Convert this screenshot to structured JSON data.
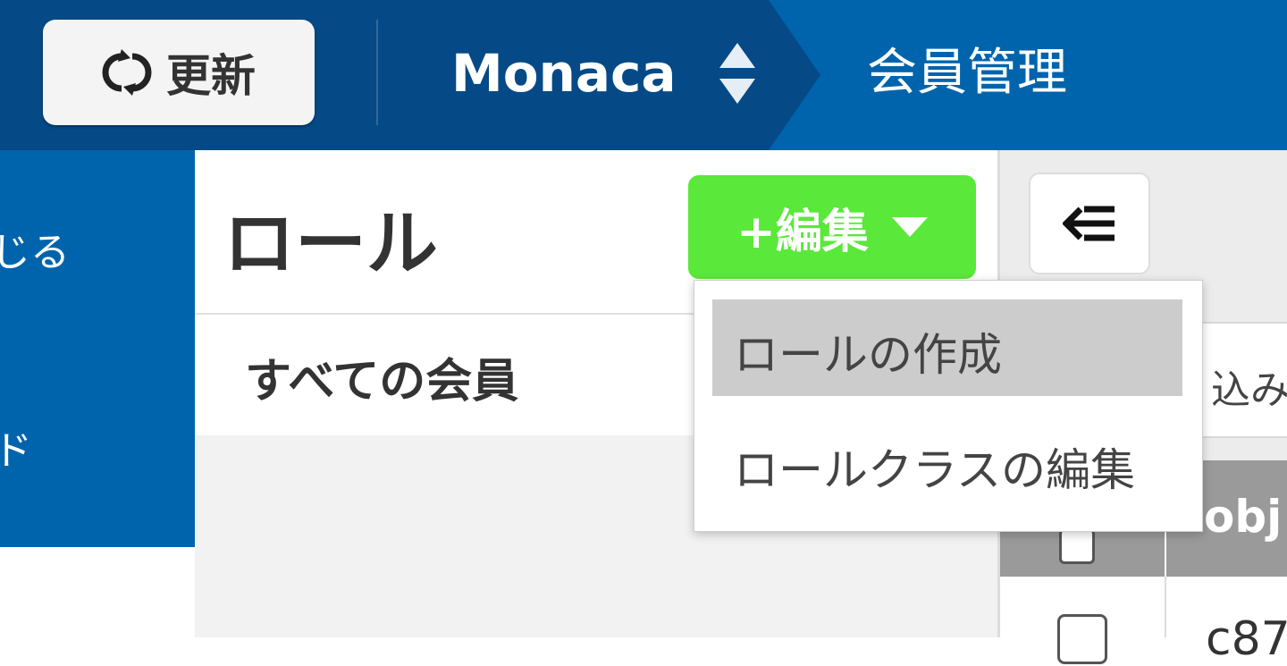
{
  "header": {
    "refresh_label": "更新",
    "app_name": "Monaca",
    "section_title": "会員管理"
  },
  "left_nav": {
    "items": [
      {
        "label": "じる"
      },
      {
        "label": "ド"
      }
    ]
  },
  "role_panel": {
    "title": "ロール",
    "edit_button_label": "+編集",
    "all_members_label": "すべての会員"
  },
  "dropdown": {
    "items": [
      {
        "label": "ロールの作成",
        "highlighted": true
      },
      {
        "label": "ロールクラスの編集",
        "highlighted": false
      }
    ]
  },
  "right_area": {
    "filter_text": "込み",
    "table": {
      "column_label": "obj",
      "row_value": "c87"
    }
  },
  "colors": {
    "header_app_bg": "#054a86",
    "header_bg": "#0064ad",
    "edit_button": "#5ae83a",
    "menu_highlight": "#cccccc"
  },
  "icons": {
    "refresh": "refresh-icon",
    "app_switcher": "sort-updown-icon",
    "collapse": "collapse-left-icon",
    "dropdown": "caret-down-icon"
  }
}
